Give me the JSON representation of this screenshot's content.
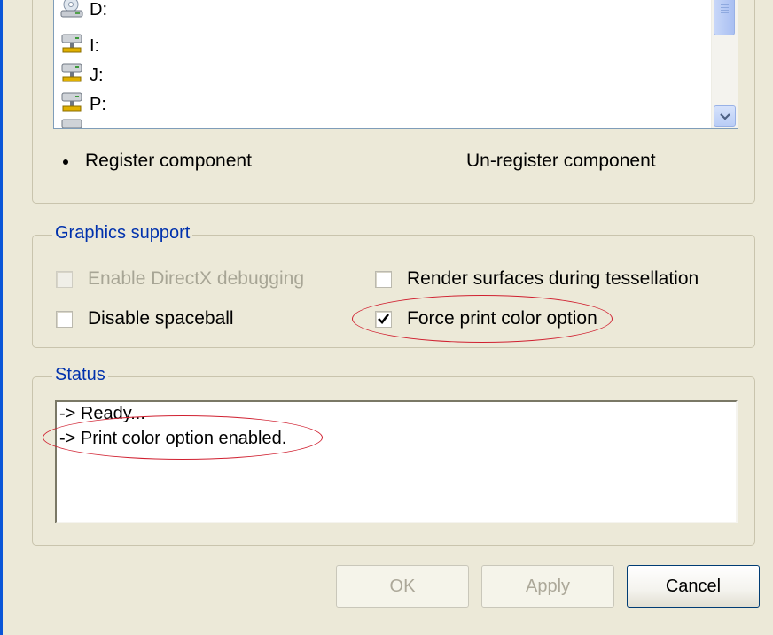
{
  "drives": [
    {
      "label": "D:",
      "icon": "cd-drive-icon"
    },
    {
      "label": "I:",
      "icon": "network-drive-icon"
    },
    {
      "label": "J:",
      "icon": "network-drive-icon"
    },
    {
      "label": "P:",
      "icon": "network-drive-icon"
    }
  ],
  "registration": {
    "register_label": "Register component",
    "unregister_label": "Un-register component",
    "selected": "register"
  },
  "graphics": {
    "legend": "Graphics support",
    "enable_directx_label": "Enable DirectX debugging",
    "render_surfaces_label": "Render surfaces during tessellation",
    "disable_spaceball_label": "Disable spaceball",
    "force_print_color_label": "Force print color option",
    "force_print_color_checked": true
  },
  "status": {
    "legend": "Status",
    "lines": [
      "-> Ready...",
      "-> Print color option enabled."
    ]
  },
  "buttons": {
    "ok": "OK",
    "apply": "Apply",
    "cancel": "Cancel"
  },
  "colors": {
    "legend": "#0031ad",
    "annotation": "#d02030",
    "list_border": "#7f9db9"
  }
}
